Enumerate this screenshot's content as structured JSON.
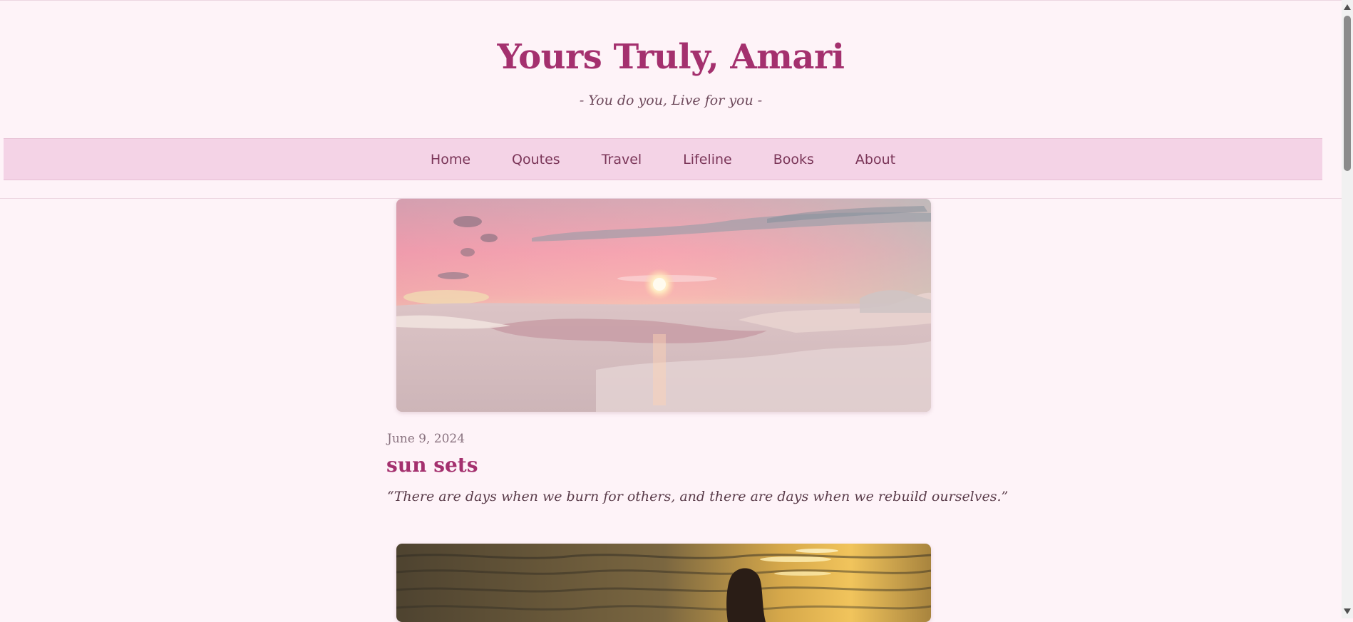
{
  "header": {
    "site_title": "Yours Truly, Amari",
    "tagline": "- You do you, Live for you -"
  },
  "nav": {
    "items": [
      "Home",
      "Qoutes",
      "Travel",
      "Lifeline",
      "Books",
      "About"
    ]
  },
  "posts": [
    {
      "image": "sunset-beach-pink-sky",
      "date": "June 9, 2024",
      "title": "sun sets",
      "excerpt": "“There are days when we burn for others, and there are days when we rebuild ourselves.”"
    },
    {
      "image": "person-in-golden-ocean-waves"
    }
  ],
  "colors": {
    "background": "#fef3f8",
    "nav_background": "#f4d3e6",
    "accent": "#a4306e",
    "text_muted": "#8a7380"
  }
}
